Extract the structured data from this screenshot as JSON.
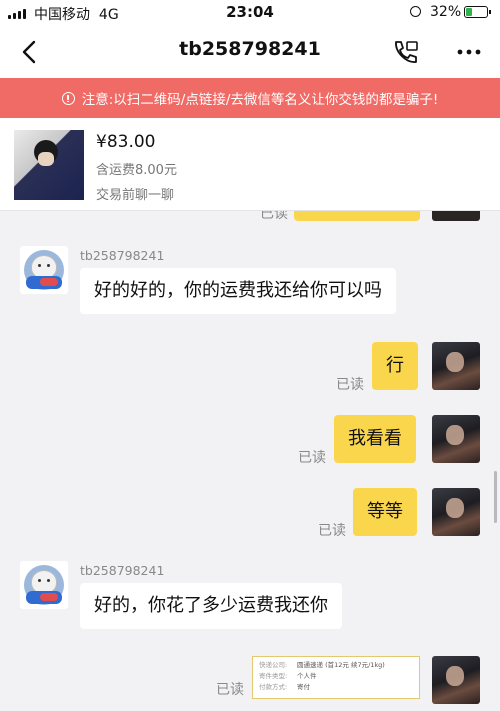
{
  "status_bar": {
    "carrier": "中国移动",
    "network": "4G",
    "time": "23:04",
    "battery_percent": "32%",
    "battery_level": 0.32
  },
  "header": {
    "title": "tb258798241",
    "icons": [
      "back-arrow-icon",
      "call-icon",
      "more-icon"
    ]
  },
  "warning": {
    "text": "注意:以扫二维码/点链接/去微信等名义让你交钱的都是骗子!"
  },
  "product": {
    "price": "¥83.00",
    "shipping": "含运费8.00元",
    "note": "交易前聊一聊"
  },
  "chat": {
    "messages": [
      {
        "from": "peer",
        "sender": "tb258798241",
        "text": "好的好的，你的运费我还给你可以吗"
      },
      {
        "from": "me",
        "text": "行",
        "status": "已读"
      },
      {
        "from": "me",
        "text": "我看看",
        "status": "已读"
      },
      {
        "from": "me",
        "text": "等等",
        "status": "已读"
      },
      {
        "from": "peer",
        "sender": "tb258798241",
        "text": "好的，你花了多少运费我还你"
      },
      {
        "from": "me",
        "type": "image",
        "status": "已读",
        "card_lines": [
          {
            "key": "快递公司:",
            "value": "圆通速递 (首12元 续7元/1kg)"
          },
          {
            "key": "寄件类型:",
            "value": "个人件"
          },
          {
            "key": "付款方式:",
            "value": "寄付"
          }
        ]
      }
    ],
    "top_partial_status": "已读"
  },
  "colors": {
    "warning_bg": "#f06a66",
    "my_bubble": "#fad64d",
    "peer_bubble": "#ffffff",
    "chat_bg": "#f2f2f4"
  }
}
